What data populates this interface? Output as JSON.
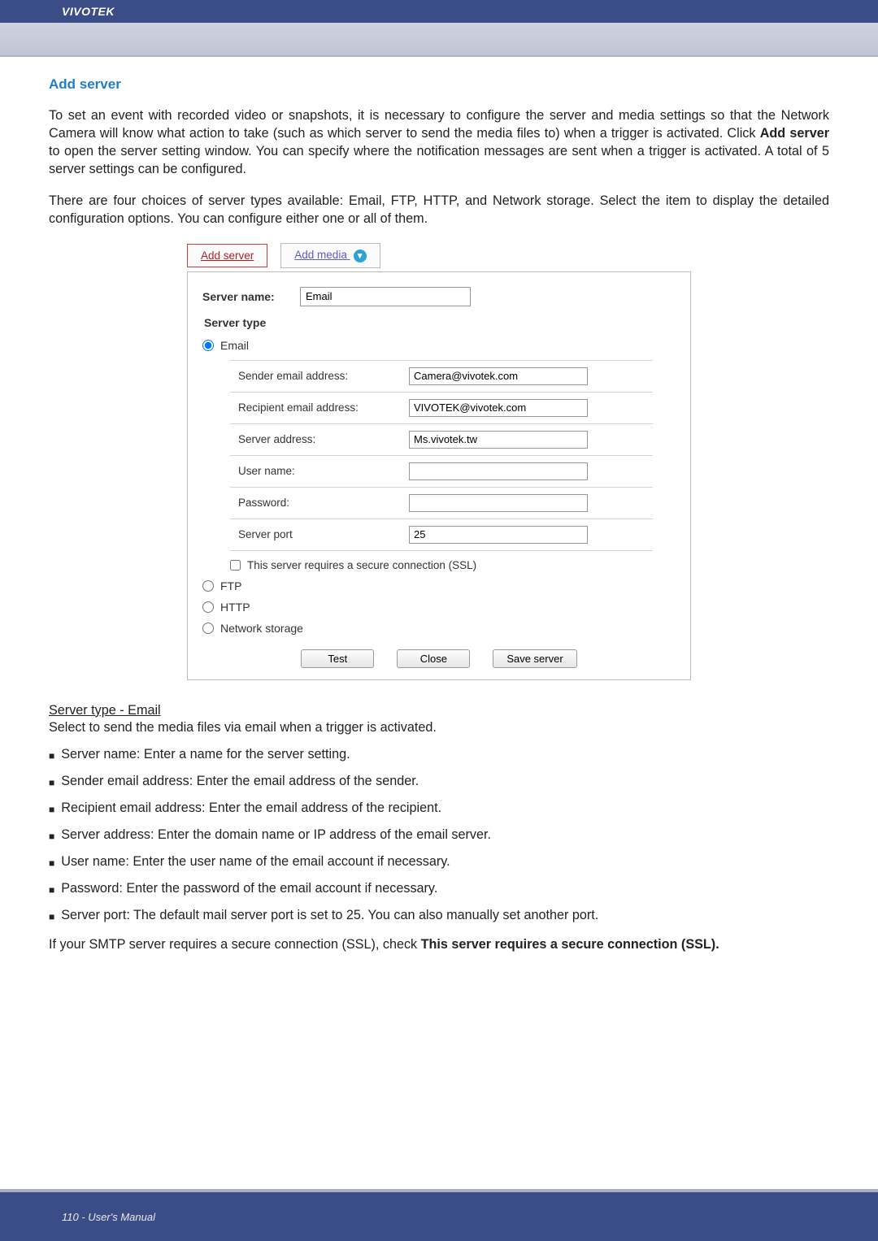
{
  "brand": "VIVOTEK",
  "footer": "110 - User's Manual",
  "section_title": "Add server",
  "para1_a": "To set an event with recorded video or snapshots, it is necessary to configure the server and media settings so that the Network Camera will know what action to take (such as which server to send the media files to) when a trigger is activated. Click ",
  "para1_bold": "Add server",
  "para1_b": " to open the server setting window. You can specify where the notification messages are sent when a trigger is activated. A total of 5 server settings can be configured.",
  "para2": "There are four choices of server types available: Email, FTP, HTTP, and Network storage. Select the item to display the detailed configuration options. You can configure either one or all of them.",
  "dialog": {
    "tab_add_server": "Add server",
    "tab_add_media": "Add media",
    "server_name_label": "Server name:",
    "server_name_value": "Email",
    "server_type_label": "Server type",
    "radio_email": "Email",
    "radio_ftp": "FTP",
    "radio_http": "HTTP",
    "radio_netstorage": "Network storage",
    "fields": {
      "sender_lbl": "Sender email address:",
      "sender_val": "Camera@vivotek.com",
      "recipient_lbl": "Recipient email address:",
      "recipient_val": "VIVOTEK@vivotek.com",
      "serveraddr_lbl": "Server address:",
      "serveraddr_val": "Ms.vivotek.tw",
      "username_lbl": "User name:",
      "username_val": "",
      "password_lbl": "Password:",
      "password_val": "",
      "port_lbl": "Server port",
      "port_val": "25"
    },
    "ssl_label": "This server requires a secure connection (SSL)",
    "btn_test": "Test",
    "btn_close": "Close",
    "btn_save": "Save server"
  },
  "server_type_email_head": "Server type - Email",
  "server_type_email_desc": "Select to send the media files via email when a trigger is activated.",
  "bullets": [
    "Server name: Enter a name for the server setting.",
    "Sender email address: Enter the email address of the sender.",
    "Recipient email address: Enter the email address of the recipient.",
    "Server address: Enter the domain name or IP address of the email server.",
    "User name: Enter the user name of the email account if necessary.",
    "Password: Enter the password of the email account if necessary.",
    "Server port: The default mail server port is set to 25. You can also manually set another port."
  ],
  "final_a": "If your SMTP server requires a secure connection (SSL), check ",
  "final_bold": "This server requires a secure connection (SSL)."
}
